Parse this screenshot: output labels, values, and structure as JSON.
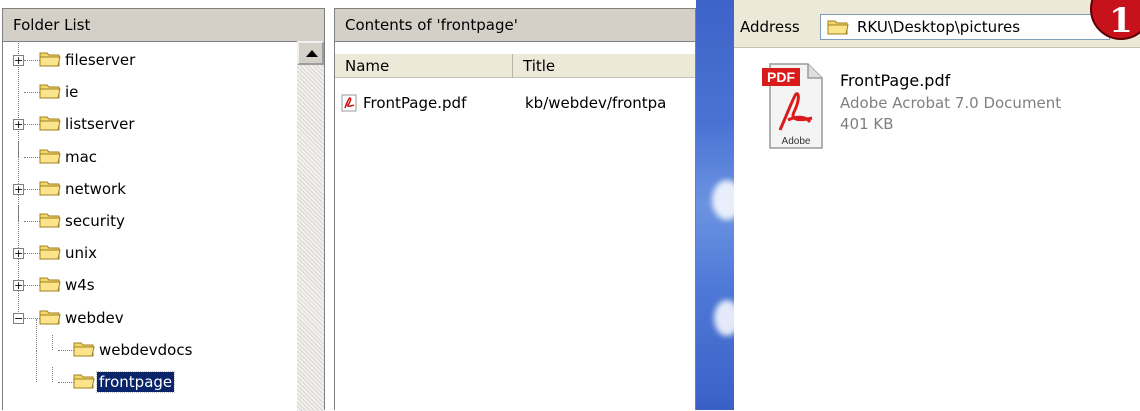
{
  "folder_pane": {
    "header": "Folder List",
    "items": [
      {
        "label": "fileserver",
        "expander": "+",
        "level": 0,
        "selected": false
      },
      {
        "label": "ie",
        "expander": "",
        "level": 0,
        "selected": false
      },
      {
        "label": "listserver",
        "expander": "+",
        "level": 0,
        "selected": false
      },
      {
        "label": "mac",
        "expander": "",
        "level": 0,
        "selected": false
      },
      {
        "label": "network",
        "expander": "+",
        "level": 0,
        "selected": false
      },
      {
        "label": "security",
        "expander": "",
        "level": 0,
        "selected": false
      },
      {
        "label": "unix",
        "expander": "+",
        "level": 0,
        "selected": false
      },
      {
        "label": "w4s",
        "expander": "+",
        "level": 0,
        "selected": false
      },
      {
        "label": "webdev",
        "expander": "−",
        "level": 0,
        "selected": false
      },
      {
        "label": "webdevdocs",
        "expander": "",
        "level": 1,
        "selected": false
      },
      {
        "label": "frontpage",
        "expander": "",
        "level": 1,
        "selected": true
      }
    ]
  },
  "contents_pane": {
    "header": "Contents of 'frontpage'",
    "columns": [
      "Name",
      "Title"
    ],
    "rows": [
      {
        "name": "FrontPage.pdf",
        "title": "kb/webdev/frontpa"
      }
    ]
  },
  "explorer": {
    "address_label": "Address",
    "address_value": "RKU\\Desktop\\pictures",
    "badge": "1",
    "file": {
      "name": "FrontPage.pdf",
      "type": "Adobe Acrobat 7.0 Document",
      "size": "401 KB",
      "icon": "pdf-document-icon"
    }
  },
  "colors": {
    "folder_yellow": "#f5d66b",
    "selection": "#0a246a",
    "header_gray": "#d4d0c8",
    "badge_red": "#c8121b",
    "desktop_blue": "#4a72d4"
  }
}
